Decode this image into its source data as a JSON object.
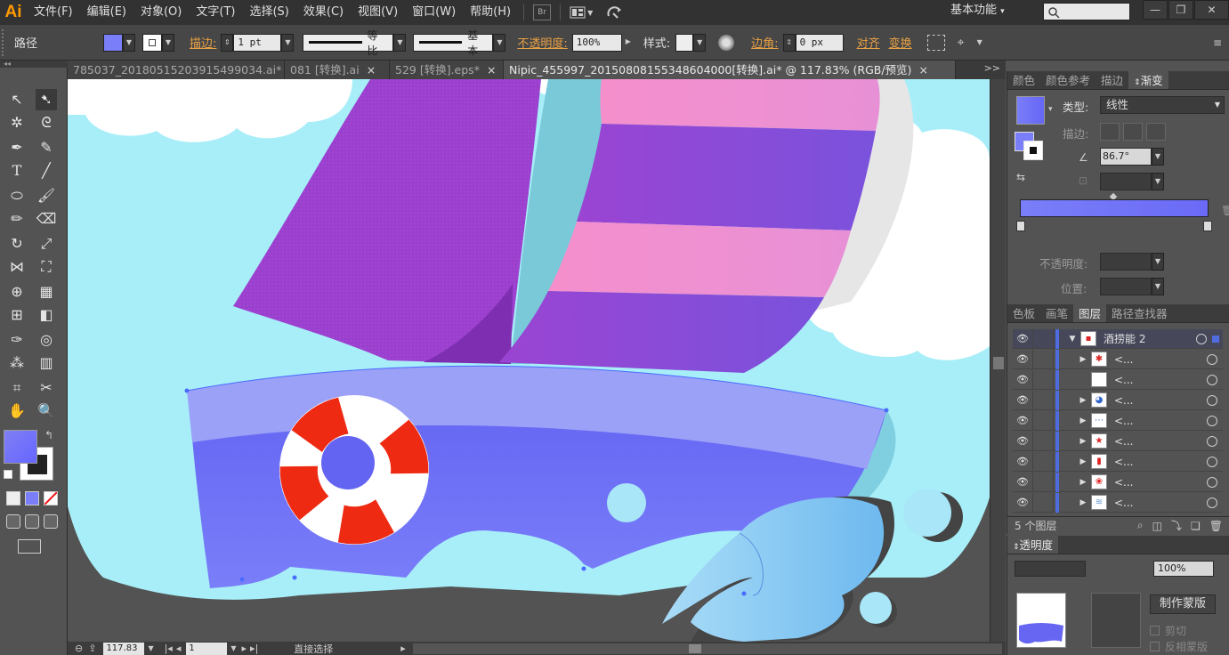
{
  "app": {
    "logo": "Ai"
  },
  "menu": [
    "文件(F)",
    "编辑(E)",
    "对象(O)",
    "文字(T)",
    "选择(S)",
    "效果(C)",
    "视图(V)",
    "窗口(W)",
    "帮助(H)"
  ],
  "menubar_icons": {
    "bridge": "Br",
    "arrange": "arrange-icon",
    "sync": "sync-icon"
  },
  "workspace": {
    "label": "基本功能"
  },
  "window_controls": [
    "minimize-icon",
    "restore-icon",
    "close-icon"
  ],
  "control": {
    "object_type": "路径",
    "fill_color": "#7a7ef8",
    "stroke_label": "描边:",
    "stroke_weight": "1 pt",
    "profile_label": "等比",
    "brush_label": "基本",
    "opacity_label": "不透明度:",
    "opacity_value": "100%",
    "style_label": "样式:",
    "corner_label": "边角:",
    "corner_value": "0 px",
    "align_label": "对齐",
    "transform_label": "变换"
  },
  "tabs": [
    {
      "label": "785037_20180515203915499034.ai*",
      "active": false
    },
    {
      "label": "081 [转换].ai",
      "active": false
    },
    {
      "label": "529 [转换].eps*",
      "active": false
    },
    {
      "label": "Nipic_455997_20150808155348604000[转换].ai* @ 117.83% (RGB/预览)",
      "active": true
    }
  ],
  "tab_close": "×",
  "tab_more": ">>",
  "status": {
    "zoom": "117.83",
    "page": "1",
    "tool": "直接选择"
  },
  "gradient_panel": {
    "tabs": [
      "颜色",
      "颜色参考",
      "描边",
      "渐变"
    ],
    "active_tab": "渐变",
    "type_label": "类型:",
    "type_value": "线性",
    "stroke_label": "描边:",
    "angle_value": "86.7°",
    "opacity_label": "不透明度:",
    "position_label": "位置:",
    "start_color": "#7a7ef8",
    "end_color": "#6a6af7"
  },
  "layers_panel": {
    "tabs": [
      "色板",
      "画笔",
      "图层",
      "路径查找器"
    ],
    "active_tab": "图层",
    "rows": [
      {
        "name": "酒捞能 2",
        "expanded": true,
        "selected": true
      },
      {
        "name": "<...",
        "expanded": false,
        "selected": false
      },
      {
        "name": "<...",
        "expanded": false,
        "selected": false
      },
      {
        "name": "<...",
        "expanded": false,
        "selected": false
      },
      {
        "name": "<...",
        "expanded": false,
        "selected": false
      },
      {
        "name": "<...",
        "expanded": false,
        "selected": false
      },
      {
        "name": "<...",
        "expanded": false,
        "selected": false
      },
      {
        "name": "<...",
        "expanded": false,
        "selected": false
      },
      {
        "name": "<...",
        "expanded": false,
        "selected": false
      }
    ],
    "count_label": "5 个图层"
  },
  "transparency_panel": {
    "title": "透明度",
    "opacity_value": "100%",
    "make_mask_button": "制作蒙版",
    "clip_label": "剪切",
    "invert_label": "反相蒙版"
  },
  "colors": {
    "sky": "#a8eef8",
    "sail_purple": "#9b3fce",
    "sail_pink": "#f48fcb",
    "hull_top": "#9ba1f7",
    "hull_body": "#6262f3",
    "ring_red": "#ee2a12",
    "wave_blue": "#8fcdf3"
  }
}
